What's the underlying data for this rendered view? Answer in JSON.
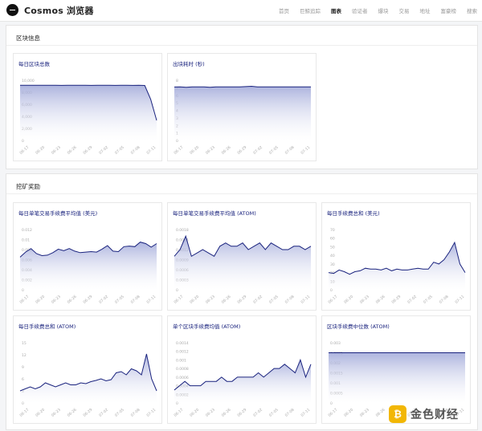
{
  "header": {
    "brand": "Cosmos 浏览器",
    "nav": [
      "首页",
      "巨鲸追踪",
      "图表",
      "验证者",
      "爆块",
      "交易",
      "地址",
      "富豪榜",
      "搜索"
    ],
    "active_index": 2
  },
  "sections": {
    "block": "区块信息",
    "mining": "挖矿奖励"
  },
  "cards": [
    {
      "title": "每日区块总数",
      "yticks": [
        "10,000",
        "8,000",
        "6,000",
        "4,000",
        "2,000",
        "0"
      ],
      "xticks": [
        "06-17",
        "06-20",
        "06-23",
        "06-26",
        "06-29",
        "07-02",
        "07-05",
        "07-08",
        "07-11"
      ]
    },
    {
      "title": "出块耗时 (秒)",
      "yticks": [
        "8",
        "7",
        "6",
        "5",
        "4",
        "3",
        "2",
        "1",
        "0"
      ],
      "xticks": [
        "06-17",
        "06-20",
        "06-23",
        "06-26",
        "06-29",
        "07-02",
        "07-05",
        "07-08",
        "07-11"
      ]
    },
    {
      "title": "每日单笔交易手续费平均值 (美元)",
      "yticks": [
        "0.012",
        "0.01",
        "0.008",
        "0.006",
        "0.004",
        "0.002",
        "0"
      ],
      "xticks": [
        "06-17",
        "06-20",
        "06-23",
        "06-26",
        "06-29",
        "07-02",
        "07-05",
        "07-08",
        "07-11"
      ]
    },
    {
      "title": "每日单笔交易手续费平均值 (ATOM)",
      "yticks": [
        "0.0018",
        "0.0015",
        "0.0012",
        "0.0009",
        "0.0006",
        "0.0003",
        "0"
      ],
      "xticks": [
        "06-17",
        "06-20",
        "06-23",
        "06-26",
        "06-29",
        "07-02",
        "07-05",
        "07-08",
        "07-11"
      ]
    },
    {
      "title": "每日手续费总和 (美元)",
      "yticks": [
        "70",
        "60",
        "50",
        "40",
        "30",
        "20",
        "10",
        "0"
      ],
      "xticks": [
        "06-17",
        "06-20",
        "06-23",
        "06-26",
        "06-29",
        "07-02",
        "07-05",
        "07-08",
        "07-11"
      ]
    },
    {
      "title": "每日手续费总和 (ATOM)",
      "yticks": [
        "15",
        "12",
        "9",
        "6",
        "3",
        "0"
      ],
      "xticks": [
        "06-17",
        "06-20",
        "06-23",
        "06-26",
        "06-29",
        "07-02",
        "07-05",
        "07-08",
        "07-11"
      ]
    },
    {
      "title": "单个区块手续费均值 (ATOM)",
      "yticks": [
        "0.0014",
        "0.0012",
        "0.001",
        "0.0008",
        "0.0006",
        "0.0004",
        "0.0002",
        "0"
      ],
      "xticks": [
        "06-17",
        "06-20",
        "06-23",
        "06-26",
        "06-29",
        "07-02",
        "07-05",
        "07-08",
        "07-11"
      ]
    },
    {
      "title": "区块手续费中位数 (ATOM)",
      "yticks": [
        "0.003",
        "0.0025",
        "0.002",
        "0.0015",
        "0.001",
        "0.0005",
        "0"
      ],
      "xticks": [
        "06-17",
        "06-20",
        "06-23",
        "06-26",
        "06-29",
        "07-02",
        "07-05",
        "07-08",
        "07-11"
      ]
    }
  ],
  "chart_data": [
    {
      "type": "area",
      "title": "每日区块总数",
      "ylim": [
        0,
        12000
      ],
      "values": [
        11000,
        11000,
        11000,
        10990,
        11000,
        11000,
        10990,
        10980,
        10990,
        11000,
        11000,
        10990,
        10980,
        10990,
        11000,
        10990,
        10980,
        10990,
        11000,
        10980,
        10990,
        10960,
        8200,
        4000
      ]
    },
    {
      "type": "area",
      "title": "出块耗时 (秒)",
      "ylim": [
        0,
        9
      ],
      "values": [
        8.0,
        8.0,
        7.95,
        8.0,
        8.0,
        8.0,
        7.95,
        8.0,
        8.0,
        8.0,
        8.0,
        8.0,
        8.05,
        8.1,
        8.0,
        8.0,
        8.0,
        8.0,
        8.0,
        8.0,
        8.0,
        8.0,
        8.0,
        8.0
      ]
    },
    {
      "type": "area",
      "title": "每日单笔交易手续费平均值 (美元)",
      "ylim": [
        0,
        0.012
      ],
      "values": [
        0.0065,
        0.0075,
        0.0082,
        0.0072,
        0.0068,
        0.0069,
        0.0074,
        0.0081,
        0.0078,
        0.0082,
        0.0077,
        0.0074,
        0.0075,
        0.0076,
        0.0075,
        0.0081,
        0.0088,
        0.0077,
        0.0076,
        0.0086,
        0.0087,
        0.0086,
        0.0095,
        0.0092,
        0.0085,
        0.0092
      ]
    },
    {
      "type": "area",
      "title": "每日单笔交易手续费平均值 (ATOM)",
      "ylim": [
        0,
        0.0018
      ],
      "values": [
        0.001,
        0.0012,
        0.0016,
        0.001,
        0.0011,
        0.0012,
        0.0011,
        0.001,
        0.0013,
        0.0014,
        0.0013,
        0.0013,
        0.0014,
        0.0012,
        0.0013,
        0.0014,
        0.0012,
        0.0014,
        0.0013,
        0.0012,
        0.0012,
        0.0013,
        0.0013,
        0.0012,
        0.0013
      ]
    },
    {
      "type": "area",
      "title": "每日手续费总和 (美元)",
      "ylim": [
        0,
        70
      ],
      "values": [
        20,
        19,
        23,
        21,
        18,
        21,
        22,
        25,
        24,
        24,
        23,
        25,
        22,
        24,
        23,
        23,
        24,
        25,
        24,
        24,
        32,
        30,
        35,
        44,
        55,
        30,
        20
      ]
    },
    {
      "type": "area",
      "title": "每日手续费总和 (ATOM)",
      "ylim": [
        0,
        15
      ],
      "values": [
        3,
        3.5,
        4,
        3.5,
        4,
        5,
        4.5,
        4,
        4.5,
        5,
        4.5,
        4.5,
        5,
        4.8,
        5.3,
        5.6,
        6,
        5.5,
        5.8,
        7.5,
        7.8,
        7,
        8.5,
        8,
        7,
        12.2,
        6,
        3
      ]
    },
    {
      "type": "area",
      "title": "单个区块手续费均值 (ATOM)",
      "ylim": [
        0,
        0.0014
      ],
      "values": [
        0.0003,
        0.0004,
        0.0005,
        0.0004,
        0.0004,
        0.0004,
        0.0005,
        0.0005,
        0.0005,
        0.0006,
        0.0005,
        0.0005,
        0.0006,
        0.0006,
        0.0006,
        0.0006,
        0.0007,
        0.0006,
        0.0007,
        0.0008,
        0.0008,
        0.0009,
        0.0008,
        0.0007,
        0.001,
        0.0006,
        0.0009
      ]
    },
    {
      "type": "area",
      "title": "区块手续费中位数 (ATOM)",
      "ylim": [
        0,
        0.003
      ],
      "values": [
        0.0025,
        0.0025,
        0.0025,
        0.0025,
        0.0025,
        0.0025,
        0.0025,
        0.0025,
        0.0025,
        0.0025,
        0.0025,
        0.0025,
        0.0025,
        0.0025,
        0.0025,
        0.0025,
        0.0025,
        0.0025,
        0.0025,
        0.0025
      ]
    }
  ],
  "watermark": {
    "icon": "₿",
    "text": "金色财经"
  },
  "colors": {
    "line": "#1a237e",
    "fill_top": "#9ea6d8",
    "fill_bottom": "#ffffff"
  }
}
